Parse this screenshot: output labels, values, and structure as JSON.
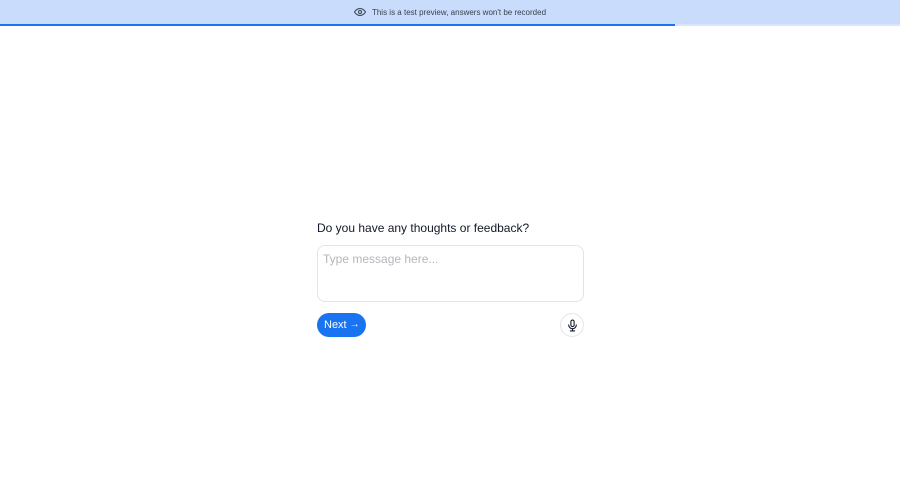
{
  "banner": {
    "icon": "eye-icon",
    "text": "This is a test preview, answers won't be recorded"
  },
  "progress": {
    "fraction": 0.75
  },
  "question": {
    "text": "Do you have any thoughts or feedback?"
  },
  "input": {
    "placeholder": "Type message here...",
    "value": ""
  },
  "actions": {
    "next_label": "Next",
    "next_icon": "arrow-right-icon",
    "mic_icon": "microphone-icon"
  },
  "colors": {
    "accent": "#1a73f0",
    "banner_bg": "#c9dcfb"
  }
}
